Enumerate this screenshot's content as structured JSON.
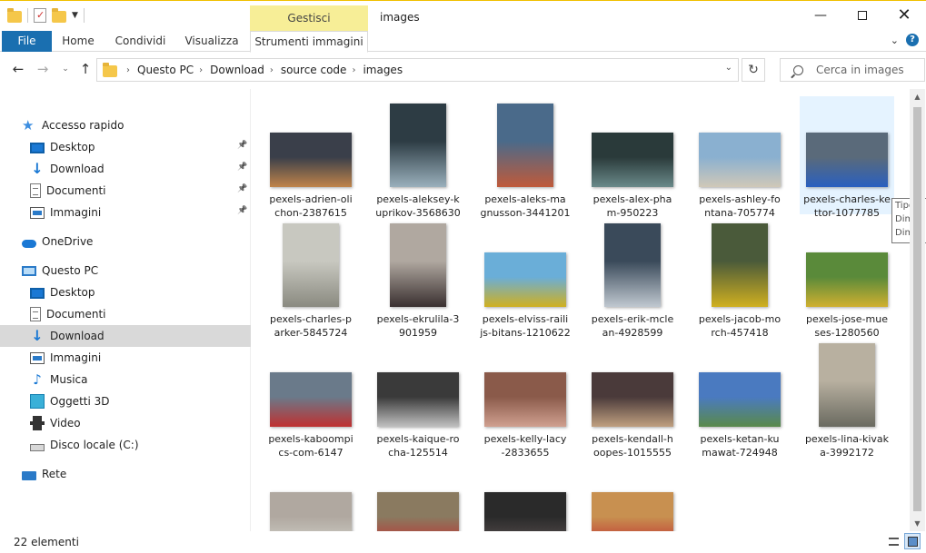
{
  "window": {
    "title": "images",
    "contextual_group": "Gestisci"
  },
  "ribbon": {
    "tabs": [
      "File",
      "Home",
      "Condividi",
      "Visualizza",
      "Strumenti immagini"
    ]
  },
  "address": {
    "crumbs": [
      "Questo PC",
      "Download",
      "source code",
      "images"
    ]
  },
  "search": {
    "placeholder": "Cerca in images"
  },
  "sidebar": {
    "items": [
      {
        "label": "Accesso rapido",
        "icon": "star-icon"
      },
      {
        "label": "Desktop",
        "icon": "desktop-icon",
        "pinned": true
      },
      {
        "label": "Download",
        "icon": "download-icon",
        "pinned": true
      },
      {
        "label": "Documenti",
        "icon": "documents-icon",
        "pinned": true
      },
      {
        "label": "Immagini",
        "icon": "pictures-icon",
        "pinned": true
      },
      {
        "label": "OneDrive",
        "icon": "onedrive-icon"
      },
      {
        "label": "Questo PC",
        "icon": "this-pc-icon"
      },
      {
        "label": "Desktop",
        "icon": "desktop-icon"
      },
      {
        "label": "Documenti",
        "icon": "documents-icon"
      },
      {
        "label": "Download",
        "icon": "download-icon",
        "selected": true
      },
      {
        "label": "Immagini",
        "icon": "pictures-icon"
      },
      {
        "label": "Musica",
        "icon": "music-icon"
      },
      {
        "label": "Oggetti 3D",
        "icon": "3d-objects-icon"
      },
      {
        "label": "Video",
        "icon": "video-icon"
      },
      {
        "label": "Disco locale (C:)",
        "icon": "local-disk-icon"
      },
      {
        "label": "Rete",
        "icon": "network-icon"
      }
    ]
  },
  "files": [
    {
      "line1": "pexels-adrien-oli",
      "line2": "chon-2387615",
      "colors": [
        "#3a3f4a",
        "#c0844a"
      ]
    },
    {
      "line1": "pexels-aleksey-k",
      "line2": "uprikov-3568630",
      "colors": [
        "#2d3c44",
        "#9ab0bc"
      ]
    },
    {
      "line1": "pexels-aleks-ma",
      "line2": "gnusson-3441201",
      "colors": [
        "#4a6a8a",
        "#c05a3a"
      ]
    },
    {
      "line1": "pexels-alex-pha",
      "line2": "m-950223",
      "colors": [
        "#2a3a3a",
        "#6a8a8a"
      ]
    },
    {
      "line1": "pexels-ashley-fo",
      "line2": "ntana-705774",
      "colors": [
        "#8ab0d0",
        "#d0c8b8"
      ]
    },
    {
      "line1": "pexels-charles-ke",
      "line2": "ttor-1077785",
      "colors": [
        "#5a6a7a",
        "#2a60c0"
      ],
      "selected": true
    },
    {
      "line1": "pexels-charles-p",
      "line2": "arker-5845724",
      "colors": [
        "#c8c8c0",
        "#8a8a80"
      ]
    },
    {
      "line1": "pexels-ekrulila-3",
      "line2": "901959",
      "colors": [
        "#b0a8a0",
        "#3a3030"
      ]
    },
    {
      "line1": "pexels-elviss-raili",
      "line2": "js-bitans-1210622",
      "colors": [
        "#6aaed8",
        "#d0b020"
      ]
    },
    {
      "line1": "pexels-erik-mcle",
      "line2": "an-4928599",
      "colors": [
        "#3a4a5a",
        "#c0c8d0"
      ]
    },
    {
      "line1": "pexels-jacob-mo",
      "line2": "rch-457418",
      "colors": [
        "#4a5a3a",
        "#d0b020"
      ]
    },
    {
      "line1": "pexels-jose-mue",
      "line2": "ses-1280560",
      "colors": [
        "#5a8a3a",
        "#d0b030"
      ]
    },
    {
      "line1": "pexels-kaboompi",
      "line2": "cs-com-6147",
      "colors": [
        "#6a7a8a",
        "#c03030"
      ]
    },
    {
      "line1": "pexels-kaique-ro",
      "line2": "cha-125514",
      "colors": [
        "#3a3a3a",
        "#c0c0c0"
      ]
    },
    {
      "line1": "pexels-kelly-lacy",
      "line2": "-2833655",
      "colors": [
        "#8a5a4a",
        "#d0a090"
      ]
    },
    {
      "line1": "pexels-kendall-h",
      "line2": "oopes-1015555",
      "colors": [
        "#4a3a3a",
        "#c0a080"
      ]
    },
    {
      "line1": "pexels-ketan-ku",
      "line2": "mawat-724948",
      "colors": [
        "#4a7ac0",
        "#5a8a4a"
      ]
    },
    {
      "line1": "pexels-lina-kivak",
      "line2": "a-3992172",
      "colors": [
        "#b8b0a0",
        "#6a6a60"
      ]
    },
    {
      "line1": "",
      "line2": "",
      "colors": [
        "#b0a8a0",
        "#d0d0c8"
      ]
    },
    {
      "line1": "",
      "line2": "",
      "colors": [
        "#8a7a60",
        "#c03030"
      ]
    },
    {
      "line1": "",
      "line2": "",
      "colors": [
        "#2a2a2a",
        "#5a5050"
      ]
    },
    {
      "line1": "",
      "line2": "",
      "colors": [
        "#c89050",
        "#c03030"
      ]
    }
  ],
  "tooltip": {
    "lines": [
      "Tipo el",
      "Dimen",
      "Dimen"
    ]
  },
  "status": {
    "count": "22 elementi"
  },
  "colors": {
    "file_tab": "#1a6fb0",
    "contextual_tab": "#f7ee97",
    "selected_nav": "#d9d9d9",
    "selected_tile": "#cce8ff"
  }
}
